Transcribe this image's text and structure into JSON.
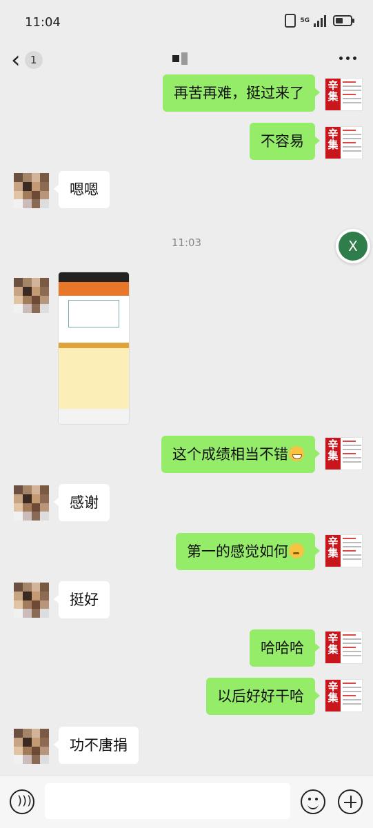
{
  "status_bar": {
    "time": "11:04",
    "network": "5G"
  },
  "nav": {
    "back_icon": "chevron-left-icon",
    "unread_count": "1",
    "more_icon": "more-dots-icon"
  },
  "messages": [
    {
      "from": "me",
      "text": "再苦再难，挺过来了"
    },
    {
      "from": "me",
      "text": "不容易"
    },
    {
      "from": "them",
      "text": "嗯嗯"
    },
    {
      "time_divider": "11:03"
    },
    {
      "from": "them",
      "type": "image"
    },
    {
      "from": "me",
      "text": "这个成绩相当不错",
      "emoji": "grinning-face"
    },
    {
      "from": "them",
      "text": "感谢"
    },
    {
      "from": "me",
      "text": "第一的感觉如何",
      "emoji": "thinking-face"
    },
    {
      "from": "them",
      "text": "挺好"
    },
    {
      "from": "me",
      "text": "哈哈哈"
    },
    {
      "from": "me",
      "text": "以后好好干哈"
    },
    {
      "from": "them",
      "text": "功不唐捐"
    }
  ],
  "my_avatar": {
    "brand_text": "辛集"
  },
  "floating_button": {
    "label": "X",
    "color": "#2f7d4a"
  },
  "input_bar": {
    "placeholder": "",
    "voice_icon": "voice-icon",
    "emoji_icon": "emoji-icon",
    "plus_icon": "plus-icon"
  },
  "colors": {
    "outgoing_bubble": "#95ec69",
    "incoming_bubble": "#ffffff",
    "background": "#ededed"
  }
}
